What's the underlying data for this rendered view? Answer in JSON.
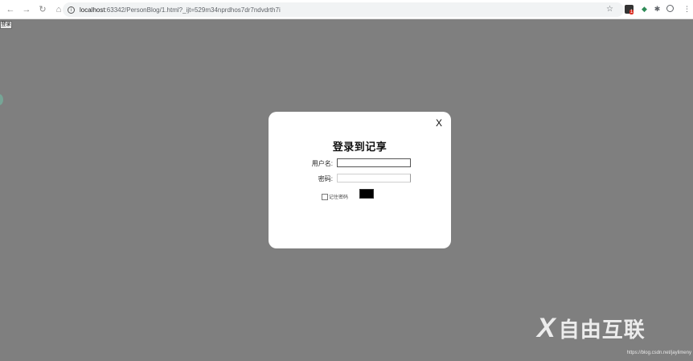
{
  "browser": {
    "url_host": "localhost",
    "url_path": ":63342/PersonBlog/1.html?_ijt=529m34nprdhos7dr7ndvdrth7i",
    "ext_badge": "1"
  },
  "page": {
    "login_button_label": "登录"
  },
  "modal": {
    "close_label": "X",
    "title": "登录到记享",
    "username_label": "用户名:",
    "password_label": "密码:",
    "remember_label": "记住密码"
  },
  "watermark": {
    "brand": "自由互联",
    "url": "https://blog.csdn.net/jaylimeny"
  },
  "colors": {
    "overlay": "#7f7f7f",
    "modal": "#ffffff"
  }
}
